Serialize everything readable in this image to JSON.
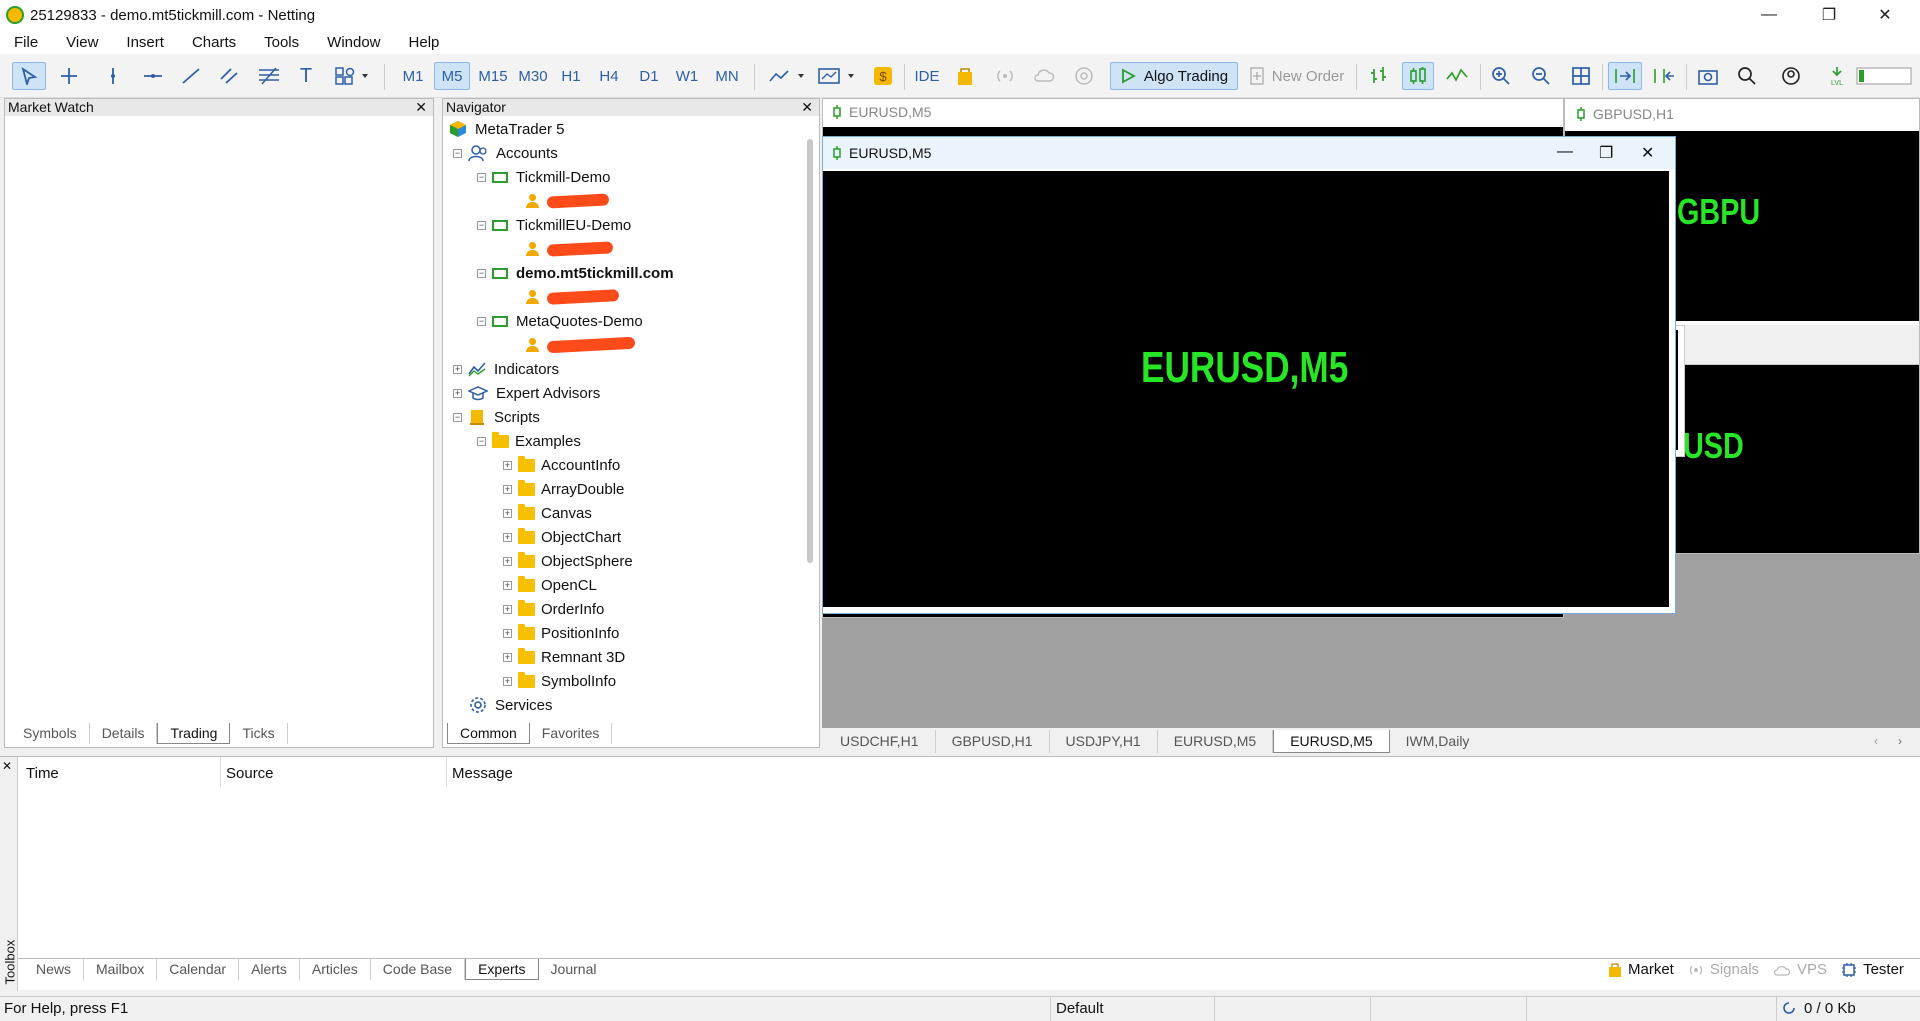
{
  "window": {
    "title": "25129833 - demo.mt5tickmill.com - Netting",
    "min": "—",
    "max": "❐",
    "close": "✕"
  },
  "menu": [
    "File",
    "View",
    "Insert",
    "Charts",
    "Tools",
    "Window",
    "Help"
  ],
  "timeframes": [
    "M1",
    "M5",
    "M15",
    "M30",
    "H1",
    "H4",
    "D1",
    "W1",
    "MN"
  ],
  "selected_timeframe": "M5",
  "toolbar": {
    "ide": "IDE",
    "algo_trading": "Algo Trading",
    "new_order": "New Order"
  },
  "market_watch": {
    "title": "Market Watch",
    "tabs": [
      "Symbols",
      "Details",
      "Trading",
      "Ticks"
    ],
    "active_tab": "Trading"
  },
  "navigator": {
    "title": "Navigator",
    "root": "MetaTrader 5",
    "accounts_label": "Accounts",
    "servers": [
      "Tickmill-Demo",
      "TickmillEU-Demo",
      "demo.mt5tickmill.com",
      "MetaQuotes-Demo"
    ],
    "indicators": "Indicators",
    "experts": "Expert Advisors",
    "scripts": "Scripts",
    "examples": "Examples",
    "example_folders": [
      "AccountInfo",
      "ArrayDouble",
      "Canvas",
      "ObjectChart",
      "ObjectSphere",
      "OpenCL",
      "OrderInfo",
      "PositionInfo",
      "Remnant 3D",
      "SymbolInfo"
    ],
    "services": "Services",
    "tabs": [
      "Common",
      "Favorites"
    ],
    "active_tab": "Common"
  },
  "charts": {
    "bg_tab": "EURUSD,M5",
    "gbp_tab": "GBPUSD,H1",
    "active_title": "EURUSD,M5",
    "active_label": "EURUSD,M5",
    "gbp_label": "GBPU",
    "usd_label": "USD",
    "bottom_tabs": [
      "USDCHF,H1",
      "GBPUSD,H1",
      "USDJPY,H1",
      "EURUSD,M5",
      "EURUSD,M5",
      "IWM,Daily"
    ],
    "active_bottom_tab": 4
  },
  "toolbox": {
    "side_label": "Toolbox",
    "columns": [
      "Time",
      "Source",
      "Message"
    ],
    "tabs": [
      "News",
      "Mailbox",
      "Calendar",
      "Alerts",
      "Articles",
      "Code Base",
      "Experts",
      "Journal"
    ],
    "active_tab": "Experts",
    "right_links": [
      "Market",
      "Signals",
      "VPS",
      "Tester"
    ]
  },
  "status": {
    "help": "For Help, press F1",
    "profile": "Default",
    "traffic": "0 / 0 Kb"
  },
  "colors": {
    "chart_bg": "#000000",
    "chart_text": "#26e626",
    "accent": "#2d5fa8",
    "redaction": "#ff4a1a"
  }
}
